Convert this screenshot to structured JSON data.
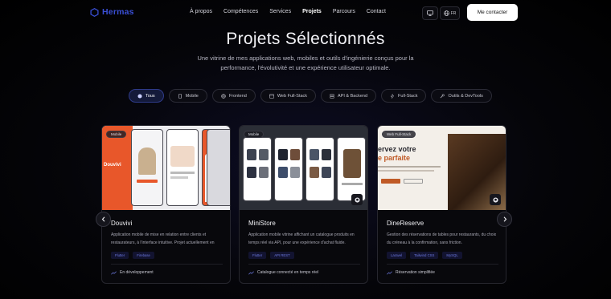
{
  "nav": {
    "brand": "Hermas",
    "links": [
      "À propos",
      "Compétences",
      "Services",
      "Projets",
      "Parcours",
      "Contact"
    ],
    "active_link": "Projets",
    "lang": "FR",
    "contact_label": "Me contacter"
  },
  "hero": {
    "title": "Projets Sélectionnés",
    "subtitle": "Une vitrine de mes applications web, mobiles et outils d'ingénierie conçus pour la performance, l'évolutivité et une expérience utilisateur optimale."
  },
  "filters": [
    {
      "label": "Tous",
      "icon": "globe-icon",
      "active": true
    },
    {
      "label": "Mobile",
      "icon": "phone-icon",
      "active": false
    },
    {
      "label": "Frontend",
      "icon": "globe-icon",
      "active": false
    },
    {
      "label": "Web Full-Stack",
      "icon": "window-icon",
      "active": false
    },
    {
      "label": "API & Backend",
      "icon": "server-icon",
      "active": false
    },
    {
      "label": "Full-Stack",
      "icon": "bolt-icon",
      "active": false
    },
    {
      "label": "Outils & DevTools",
      "icon": "wrench-icon",
      "active": false
    }
  ],
  "projects": [
    {
      "badge": "Mobile",
      "title": "Douvivi",
      "description": "Application mobile de mise en relation entre clients et restaurateurs, à l'interface intuitive. Projet actuellement en développement.",
      "tags": [
        "Flutter",
        "Firebase"
      ],
      "status": "En développement"
    },
    {
      "badge": "Mobile",
      "title": "MiniStore",
      "description": "Application mobile vitrine affichant un catalogue produits en temps réel via API, pour une expérience d'achat fluide.",
      "tags": [
        "Flutter",
        "API REST"
      ],
      "status": "Catalogue connecté en temps réel"
    },
    {
      "badge": "Web Full-Stack",
      "title": "DineReserve",
      "description": "Gestion des réservations de tables pour restaurants, du choix du créneau à la confirmation, sans friction.",
      "tags": [
        "Laravel",
        "Tailwind CSS",
        "MySQL"
      ],
      "status": "Réservation simplifiée",
      "hero_text_1": "ervez votre",
      "hero_text_2": "e parfaite"
    }
  ],
  "colors": {
    "accent": "#3a4fd6",
    "tag_text": "#6d7ae0",
    "douvivi_orange": "#e8572a"
  }
}
